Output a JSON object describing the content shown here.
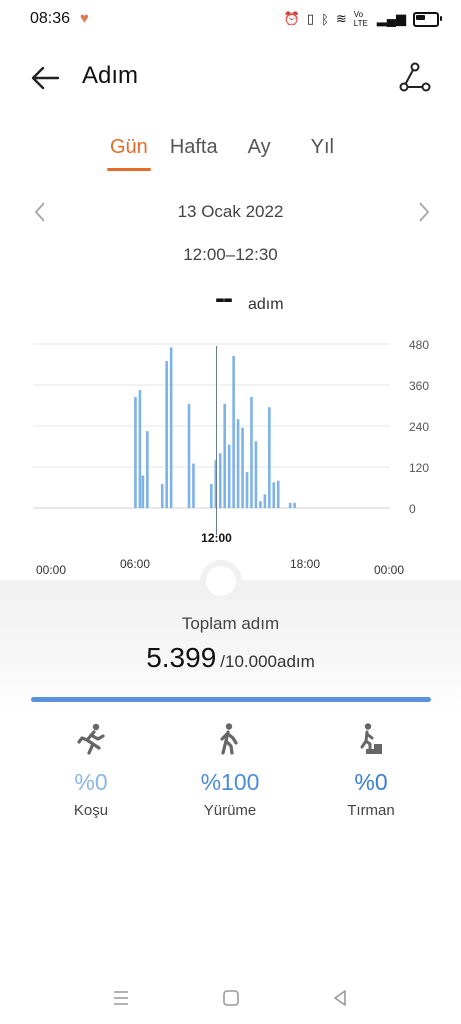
{
  "status": {
    "time": "08:36",
    "heart": "♥",
    "net": "Vo LTE"
  },
  "header": {
    "title": "Adım"
  },
  "tabs": [
    {
      "label": "Gün",
      "active": true
    },
    {
      "label": "Hafta",
      "active": false
    },
    {
      "label": "Ay",
      "active": false
    },
    {
      "label": "Yıl",
      "active": false
    }
  ],
  "date": "13 Ocak 2022",
  "time_range": "12:00–12:30",
  "current": {
    "value": "--",
    "unit": "adım"
  },
  "chart_data": {
    "type": "bar",
    "title": "",
    "xlabel": "",
    "ylabel": "",
    "x_ticks": [
      "00:00",
      "06:00",
      "12:00",
      "18:00",
      "00:00"
    ],
    "y_ticks": [
      "480",
      "360",
      "240",
      "120",
      "0"
    ],
    "ylim": [
      0,
      480
    ],
    "selected_label": "12:00",
    "bar_color": "#7db3e6",
    "bars": [
      {
        "h": 6.8,
        "v": 325
      },
      {
        "h": 7.1,
        "v": 345
      },
      {
        "h": 7.3,
        "v": 95
      },
      {
        "h": 7.6,
        "v": 225
      },
      {
        "h": 8.6,
        "v": 70
      },
      {
        "h": 8.9,
        "v": 430
      },
      {
        "h": 9.2,
        "v": 470
      },
      {
        "h": 10.4,
        "v": 305
      },
      {
        "h": 10.7,
        "v": 130
      },
      {
        "h": 11.9,
        "v": 70
      },
      {
        "h": 12.2,
        "v": 140
      },
      {
        "h": 12.5,
        "v": 160
      },
      {
        "h": 12.8,
        "v": 305
      },
      {
        "h": 13.1,
        "v": 185
      },
      {
        "h": 13.4,
        "v": 445
      },
      {
        "h": 13.7,
        "v": 260
      },
      {
        "h": 14.0,
        "v": 235
      },
      {
        "h": 14.3,
        "v": 105
      },
      {
        "h": 14.6,
        "v": 325
      },
      {
        "h": 14.9,
        "v": 195
      },
      {
        "h": 15.2,
        "v": 20
      },
      {
        "h": 15.5,
        "v": 40
      },
      {
        "h": 15.8,
        "v": 295
      },
      {
        "h": 16.1,
        "v": 75
      },
      {
        "h": 16.4,
        "v": 80
      },
      {
        "h": 17.2,
        "v": 15
      },
      {
        "h": 17.5,
        "v": 15
      }
    ]
  },
  "summary": {
    "label": "Toplam adım",
    "value": "5.399",
    "goal": "/10.000adım",
    "progress": 1.0
  },
  "stats": [
    {
      "icon": "running-icon",
      "pct": "%0",
      "label": "Koşu",
      "color": "#8ab8e6"
    },
    {
      "icon": "walking-icon",
      "pct": "%100",
      "label": "Yürüme",
      "color": "#4c8ddb"
    },
    {
      "icon": "climbing-icon",
      "pct": "%0",
      "label": "Tırman",
      "color": "#3a7fd4"
    }
  ],
  "colors": {
    "accent": "#e46c2a",
    "bar": "#7db3e6",
    "progress": "#5b92de"
  }
}
